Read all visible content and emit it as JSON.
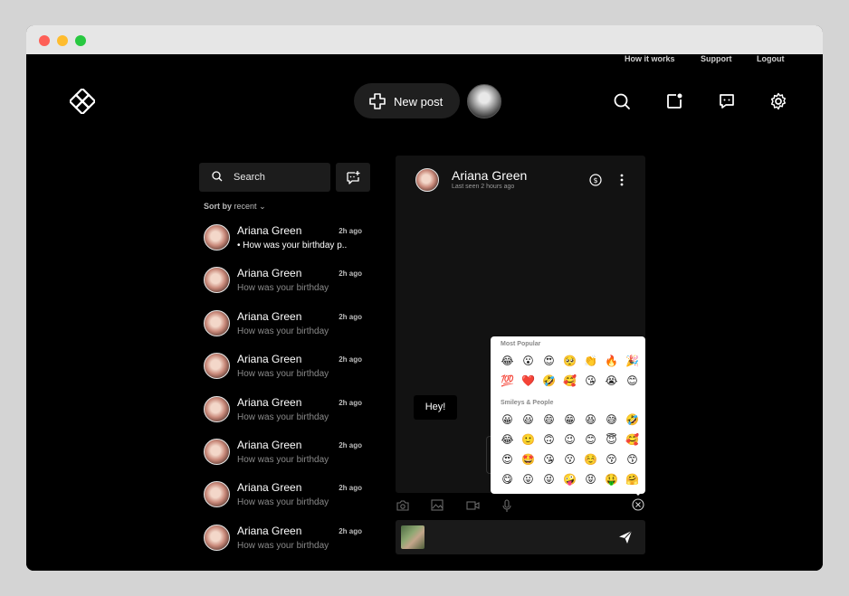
{
  "top_nav": {
    "links": [
      "How it works",
      "Support",
      "Logout"
    ],
    "new_post_label": "New post",
    "icons": [
      "logo-icon",
      "search-icon",
      "notification-icon",
      "chat-icon",
      "settings-icon"
    ]
  },
  "sidebar": {
    "search_placeholder": "Search",
    "sort_prefix": "Sort by",
    "sort_value": "recent",
    "conversations": [
      {
        "name": "Ariana Green",
        "time": "2h ago",
        "preview": "•  How was your birthday p..",
        "unread": true
      },
      {
        "name": "Ariana Green",
        "time": "2h ago",
        "preview": "How was your birthday",
        "unread": false
      },
      {
        "name": "Ariana Green",
        "time": "2h ago",
        "preview": "How was your birthday",
        "unread": false
      },
      {
        "name": "Ariana Green",
        "time": "2h ago",
        "preview": "How was your birthday",
        "unread": false
      },
      {
        "name": "Ariana Green",
        "time": "2h ago",
        "preview": "How was your birthday",
        "unread": false
      },
      {
        "name": "Ariana Green",
        "time": "2h ago",
        "preview": "How was your birthday",
        "unread": false
      },
      {
        "name": "Ariana Green",
        "time": "2h ago",
        "preview": "How was your birthday",
        "unread": false
      },
      {
        "name": "Ariana Green",
        "time": "2h ago",
        "preview": "How was your birthday",
        "unread": false
      }
    ]
  },
  "chat": {
    "name": "Ariana Green",
    "status": "Last seen 2 hours ago",
    "messages": [
      {
        "text": "Hey!",
        "from": "self"
      }
    ]
  },
  "emoji_picker": {
    "section_popular": "Most Popular",
    "popular": [
      "😂",
      "😮",
      "😍",
      "🥺",
      "👏",
      "🔥",
      "🎉",
      "💯",
      "❤️",
      "🤣",
      "🥰",
      "😘",
      "😭",
      "😊"
    ],
    "section_smileys": "Smileys & People",
    "smileys": [
      "😀",
      "😃",
      "😄",
      "😁",
      "😆",
      "😅",
      "🤣",
      "😂",
      "🙂",
      "🙃",
      "😉",
      "😊",
      "😇",
      "🥰",
      "😍",
      "🤩",
      "😘",
      "😗",
      "☺️",
      "😚",
      "😙",
      "😋",
      "😛",
      "😜",
      "🤪",
      "😝",
      "🤑",
      "🤗"
    ]
  },
  "composer": {
    "tool_icons": [
      "camera-icon",
      "image-icon",
      "video-icon",
      "microphone-icon",
      "close-icon"
    ],
    "send_icon": "send-icon"
  },
  "colors": {
    "background": "#000000",
    "panel": "#121212",
    "accent": "#ffffff"
  }
}
